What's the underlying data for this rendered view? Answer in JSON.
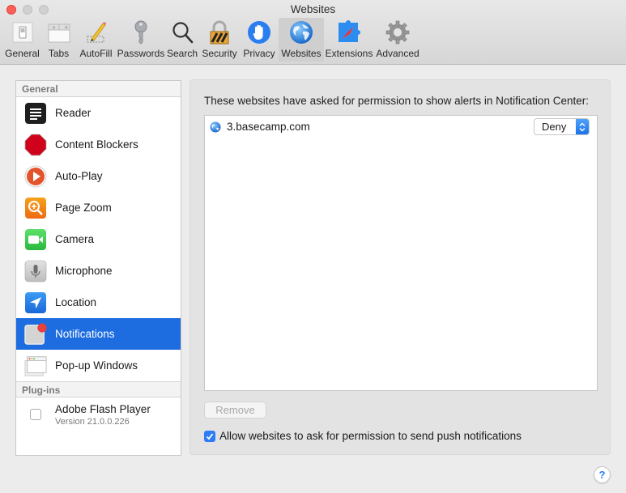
{
  "window": {
    "title": "Websites"
  },
  "toolbar": {
    "items": [
      {
        "label": "General",
        "icon": "general-switch-icon"
      },
      {
        "label": "Tabs",
        "icon": "tabs-icon"
      },
      {
        "label": "AutoFill",
        "icon": "pencil-icon"
      },
      {
        "label": "Passwords",
        "icon": "key-icon"
      },
      {
        "label": "Search",
        "icon": "magnifier-icon"
      },
      {
        "label": "Security",
        "icon": "padlock-icon"
      },
      {
        "label": "Privacy",
        "icon": "hand-icon"
      },
      {
        "label": "Websites",
        "icon": "globe-icon",
        "active": true
      },
      {
        "label": "Extensions",
        "icon": "puzzle-compass-icon"
      },
      {
        "label": "Advanced",
        "icon": "gear-icon"
      }
    ]
  },
  "sidebar": {
    "general_header": "General",
    "items": [
      {
        "label": "Reader",
        "icon": "reader-icon"
      },
      {
        "label": "Content Blockers",
        "icon": "stop-sign-icon"
      },
      {
        "label": "Auto-Play",
        "icon": "play-icon"
      },
      {
        "label": "Page Zoom",
        "icon": "zoom-icon"
      },
      {
        "label": "Camera",
        "icon": "camera-icon"
      },
      {
        "label": "Microphone",
        "icon": "microphone-icon"
      },
      {
        "label": "Location",
        "icon": "location-arrow-icon"
      },
      {
        "label": "Notifications",
        "icon": "notification-badge-icon",
        "selected": true
      },
      {
        "label": "Pop-up Windows",
        "icon": "popup-windows-icon"
      }
    ],
    "plugins_header": "Plug-ins",
    "plugins": [
      {
        "name": "Adobe Flash Player",
        "version": "Version 21.0.0.226",
        "enabled": false
      }
    ]
  },
  "panel": {
    "description": "These websites have asked for permission to show alerts in Notification Center:",
    "sites": [
      {
        "domain": "3.basecamp.com",
        "permission": "Deny"
      }
    ],
    "remove_label": "Remove",
    "allow_checkbox": {
      "label": "Allow websites to ask for permission to send push notifications",
      "checked": true
    }
  },
  "help": {
    "label": "?"
  },
  "colors": {
    "accent": "#1d6de0",
    "close": "#fc5f57",
    "checkbox": "#2d7cf6"
  }
}
